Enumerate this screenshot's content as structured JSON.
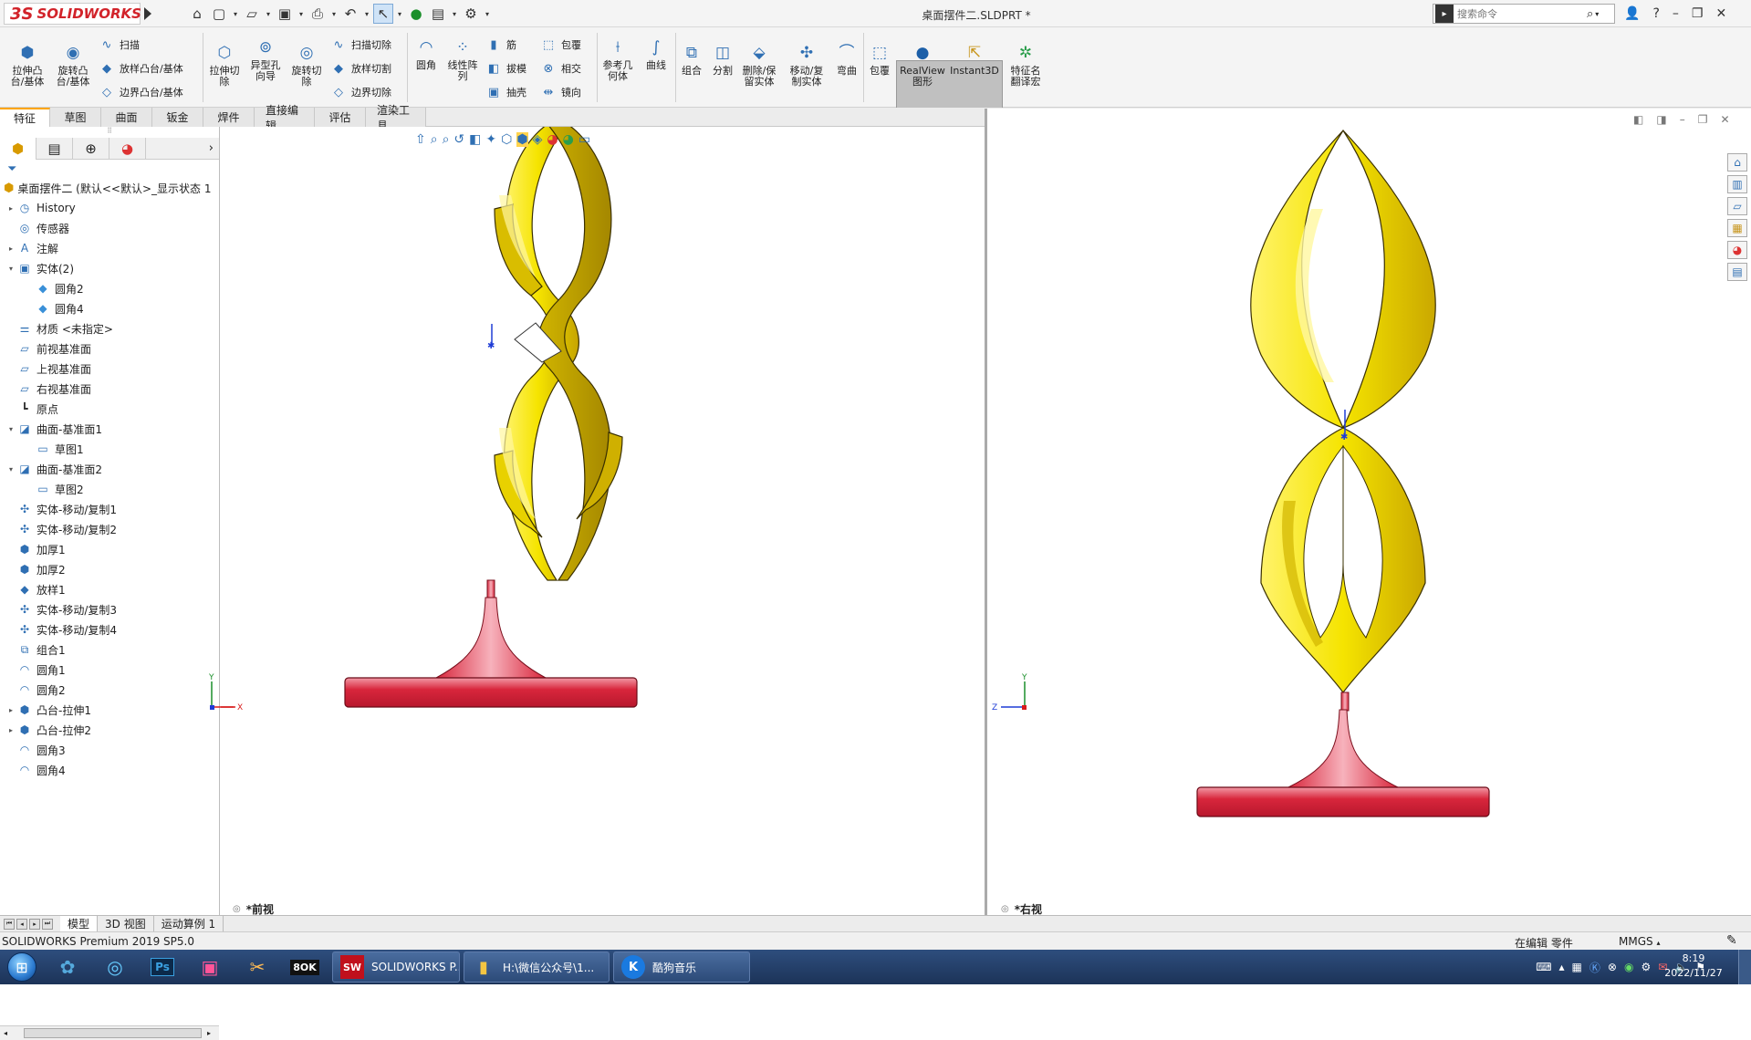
{
  "titlebar": {
    "logo_text": "SOLIDWORKS",
    "logo_prefix": "3S",
    "document_title": "桌面摆件二.SLDPRT *",
    "search_placeholder": "搜索命令",
    "quick_access_icons": [
      "home-icon",
      "new-icon",
      "open-icon",
      "save-icon",
      "print-icon",
      "undo-icon",
      "select-icon",
      "rebuild-icon",
      "file-properties-icon",
      "options-icon"
    ]
  },
  "ribbon": {
    "large_buttons": [
      {
        "label": "拉伸凸\n台/基体",
        "icon": "extrude-boss-icon"
      },
      {
        "label": "旋转凸\n台/基体",
        "icon": "revolve-boss-icon"
      },
      {
        "label": "拉伸切\n除",
        "icon": "extrude-cut-icon"
      },
      {
        "label": "异型孔\n向导",
        "icon": "hole-wizard-icon"
      },
      {
        "label": "旋转切\n除",
        "icon": "revolve-cut-icon"
      },
      {
        "label": "圆角",
        "icon": "fillet-icon"
      },
      {
        "label": "线性阵\n列",
        "icon": "linear-pattern-icon"
      },
      {
        "label": "参考几\n何体",
        "icon": "reference-geometry-icon"
      },
      {
        "label": "曲线",
        "icon": "curves-icon"
      },
      {
        "label": "组合",
        "icon": "combine-icon"
      },
      {
        "label": "分割",
        "icon": "split-icon"
      },
      {
        "label": "删除/保\n留实体",
        "icon": "delete-keep-body-icon"
      },
      {
        "label": "移动/复\n制实体",
        "icon": "move-copy-body-icon"
      },
      {
        "label": "弯曲",
        "icon": "flex-icon"
      },
      {
        "label": "包覆",
        "icon": "wrap-icon"
      },
      {
        "label": "RealView\n图形",
        "icon": "realview-icon"
      },
      {
        "label": "Instant3D",
        "icon": "instant3d-icon"
      },
      {
        "label": "特征名\n翻译宏",
        "icon": "macro-icon"
      }
    ],
    "small_buttons": [
      {
        "label": "扫描",
        "icon": "sweep-icon"
      },
      {
        "label": "放样凸台/基体",
        "icon": "loft-icon"
      },
      {
        "label": "边界凸台/基体",
        "icon": "boundary-icon"
      },
      {
        "label": "扫描切除",
        "icon": "swept-cut-icon"
      },
      {
        "label": "放样切割",
        "icon": "lofted-cut-icon"
      },
      {
        "label": "边界切除",
        "icon": "boundary-cut-icon"
      },
      {
        "label": "筋",
        "icon": "rib-icon"
      },
      {
        "label": "拔模",
        "icon": "draft-icon"
      },
      {
        "label": "抽壳",
        "icon": "shell-icon"
      },
      {
        "label": "包覆",
        "icon": "wrap-icon"
      },
      {
        "label": "相交",
        "icon": "intersect-icon"
      },
      {
        "label": "镜向",
        "icon": "mirror-icon"
      }
    ]
  },
  "tabs": [
    "特征",
    "草图",
    "曲面",
    "钣金",
    "焊件",
    "直接编辑",
    "评估",
    "渲染工具"
  ],
  "sidebar": {
    "root": "桌面摆件二  (默认<<默认>_显示状态 1",
    "items": [
      {
        "label": "History",
        "expander": "▸",
        "icon": "history-icon",
        "indent": 0
      },
      {
        "label": "传感器",
        "expander": "",
        "icon": "sensor-icon",
        "indent": 0
      },
      {
        "label": "注解",
        "expander": "▸",
        "icon": "annotation-icon",
        "indent": 0
      },
      {
        "label": "实体(2)",
        "expander": "▾",
        "icon": "solid-bodies-icon",
        "indent": 0
      },
      {
        "label": "圆角2",
        "expander": "",
        "icon": "body-icon",
        "indent": 1
      },
      {
        "label": "圆角4",
        "expander": "",
        "icon": "body-icon",
        "indent": 1
      },
      {
        "label": "材质 <未指定>",
        "expander": "",
        "icon": "material-icon",
        "indent": 0
      },
      {
        "label": "前视基准面",
        "expander": "",
        "icon": "plane-icon",
        "indent": 0
      },
      {
        "label": "上视基准面",
        "expander": "",
        "icon": "plane-icon",
        "indent": 0
      },
      {
        "label": "右视基准面",
        "expander": "",
        "icon": "plane-icon",
        "indent": 0
      },
      {
        "label": "原点",
        "expander": "",
        "icon": "origin-icon",
        "indent": 0
      },
      {
        "label": "曲面-基准面1",
        "expander": "▾",
        "icon": "surface-plane-icon",
        "indent": 0
      },
      {
        "label": "草图1",
        "expander": "",
        "icon": "sketch-icon",
        "indent": 1
      },
      {
        "label": "曲面-基准面2",
        "expander": "▾",
        "icon": "surface-plane-icon",
        "indent": 0
      },
      {
        "label": "草图2",
        "expander": "",
        "icon": "sketch-icon",
        "indent": 1
      },
      {
        "label": "实体-移动/复制1",
        "expander": "",
        "icon": "move-copy-icon",
        "indent": 0
      },
      {
        "label": "实体-移动/复制2",
        "expander": "",
        "icon": "move-copy-icon",
        "indent": 0
      },
      {
        "label": "加厚1",
        "expander": "",
        "icon": "thicken-icon",
        "indent": 0
      },
      {
        "label": "加厚2",
        "expander": "",
        "icon": "thicken-icon",
        "indent": 0
      },
      {
        "label": "放样1",
        "expander": "",
        "icon": "loft-feature-icon",
        "indent": 0
      },
      {
        "label": "实体-移动/复制3",
        "expander": "",
        "icon": "move-copy-icon",
        "indent": 0
      },
      {
        "label": "实体-移动/复制4",
        "expander": "",
        "icon": "move-copy-icon",
        "indent": 0
      },
      {
        "label": "组合1",
        "expander": "",
        "icon": "combine-feature-icon",
        "indent": 0
      },
      {
        "label": "圆角1",
        "expander": "",
        "icon": "fillet-feature-icon",
        "indent": 0
      },
      {
        "label": "圆角2",
        "expander": "",
        "icon": "fillet-feature-icon",
        "indent": 0
      },
      {
        "label": "凸台-拉伸1",
        "expander": "▸",
        "icon": "extrude-feature-icon",
        "indent": 0
      },
      {
        "label": "凸台-拉伸2",
        "expander": "▸",
        "icon": "extrude-feature-icon",
        "indent": 0
      },
      {
        "label": "圆角3",
        "expander": "",
        "icon": "fillet-feature-icon",
        "indent": 0
      },
      {
        "label": "圆角4",
        "expander": "",
        "icon": "fillet-feature-icon",
        "indent": 0
      }
    ]
  },
  "viewports": {
    "left_label": "*前视",
    "right_label": "*右视",
    "colors": {
      "twist": "#f2e200",
      "twist_shade": "#c9a700",
      "base": "#d8263c",
      "base_light": "#f08090"
    }
  },
  "bottom_tabs": [
    "模型",
    "3D 视图",
    "运动算例 1"
  ],
  "status": {
    "left": "SOLIDWORKS Premium 2019 SP5.0",
    "editing": "在编辑 零件",
    "units": "MMGS"
  },
  "taskbar": {
    "apps": [
      {
        "label": "SOLIDWORKS P...",
        "icon": "solidworks-icon"
      },
      {
        "label": "H:\\微信公众号\\1...",
        "icon": "folder-icon"
      },
      {
        "label": "酷狗音乐",
        "icon": "kugou-icon"
      }
    ],
    "time": "8:19",
    "date": "2022/11/27"
  }
}
